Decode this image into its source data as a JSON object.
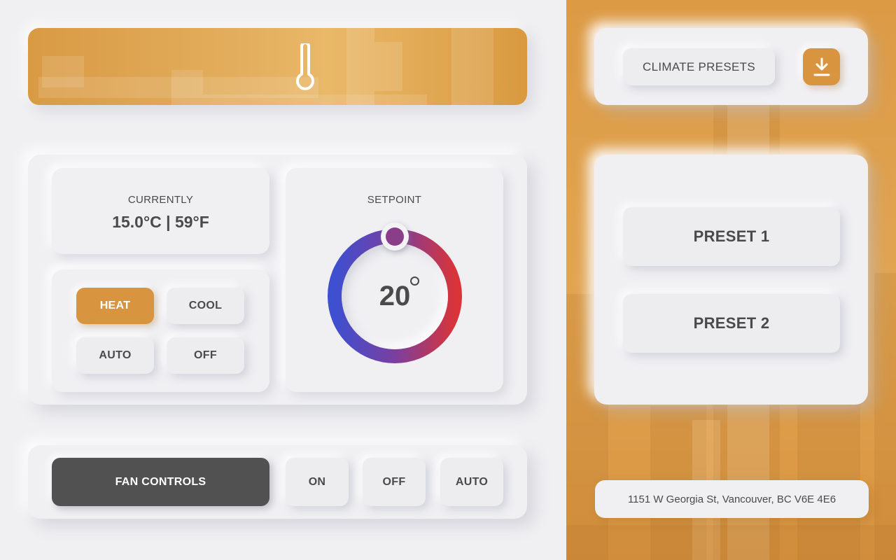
{
  "current": {
    "label": "CURRENTLY",
    "reading": "15.0°C | 59°F"
  },
  "setpoint": {
    "label": "SETPOINT",
    "value": "20"
  },
  "modes": [
    {
      "label": "HEAT",
      "active": true
    },
    {
      "label": "COOL",
      "active": false
    },
    {
      "label": "AUTO",
      "active": false
    },
    {
      "label": "OFF",
      "active": false
    }
  ],
  "fan": {
    "title": "FAN CONTROLS",
    "options": [
      "ON",
      "OFF",
      "AUTO"
    ]
  },
  "presets": {
    "title": "CLIMATE PRESETS",
    "items": [
      "PRESET 1",
      "PRESET 2"
    ]
  },
  "address": "1151 W Georgia St, Vancouver, BC V6E 4E6",
  "icons": {
    "banner": "thermometer-icon",
    "download": "download-icon"
  },
  "colors": {
    "accent": "#d9943f",
    "dark_button": "#515151",
    "dial_start": "#3e4fd0",
    "dial_end": "#d8343a",
    "knob": "#8a3e8a"
  }
}
